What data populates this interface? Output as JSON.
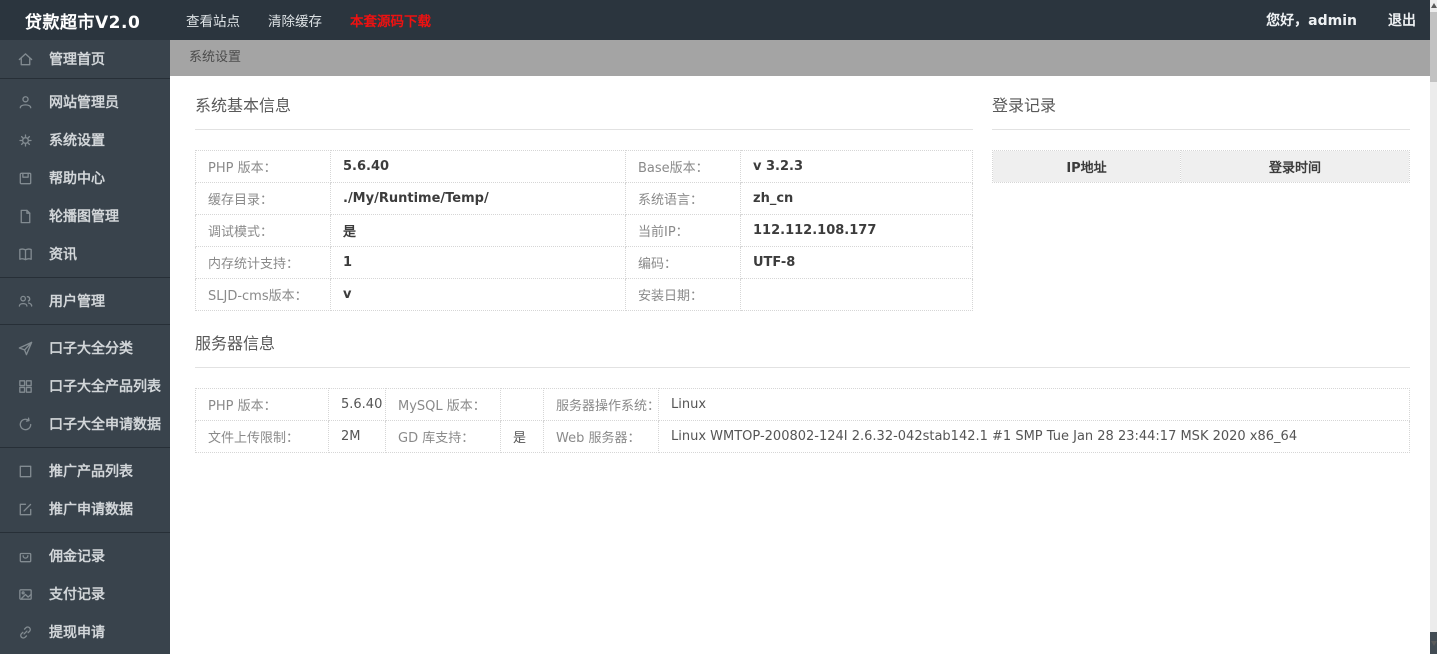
{
  "topbar": {
    "logo": "贷款超市V2.0",
    "menu": [
      {
        "label": "查看站点"
      },
      {
        "label": "清除缓存"
      },
      {
        "label": "本套源码下载"
      }
    ],
    "greeting": "您好，admin",
    "logout": "退出",
    "colors": {
      "background": "#2b353e",
      "danger_link": "#ee1111"
    }
  },
  "breadcrumb": {
    "label": "系统设置"
  },
  "sidebar": {
    "colors": {
      "background": "#39434c",
      "text": "#d2d6d9",
      "icon": "#828b91"
    },
    "items": [
      {
        "icon": "home-icon",
        "label": "管理首页"
      },
      {
        "icon": "user-icon",
        "label": "网站管理员"
      },
      {
        "icon": "gear-icon",
        "label": "系统设置"
      },
      {
        "icon": "save-icon",
        "label": "帮助中心"
      },
      {
        "icon": "file-icon",
        "label": "轮播图管理"
      },
      {
        "icon": "book-icon",
        "label": "资讯"
      },
      {
        "icon": "users-icon",
        "label": "用户管理"
      },
      {
        "icon": "send-icon",
        "label": "口子大全分类"
      },
      {
        "icon": "grid-icon",
        "label": "口子大全产品列表"
      },
      {
        "icon": "refresh-icon",
        "label": "口子大全申请数据"
      },
      {
        "icon": "square-icon",
        "label": "推广产品列表"
      },
      {
        "icon": "edit-icon",
        "label": "推广申请数据"
      },
      {
        "icon": "bag-icon",
        "label": "佣金记录"
      },
      {
        "icon": "image-icon",
        "label": "支付记录"
      },
      {
        "icon": "link-icon",
        "label": "提现申请"
      }
    ]
  },
  "sections": {
    "basic": {
      "title": "系统基本信息",
      "rows": [
        [
          "PHP 版本：",
          "5.6.40",
          "Base版本：",
          "v 3.2.3"
        ],
        [
          "缓存目录：",
          "./My/Runtime/Temp/",
          "系统语言：",
          "zh_cn"
        ],
        [
          "调试模式：",
          "是",
          "当前IP：",
          "112.112.108.177"
        ],
        [
          "内存统计支持：",
          "1",
          "编码：",
          "UTF-8"
        ],
        [
          "SLJD-cms版本：",
          "v",
          "安装日期：",
          ""
        ]
      ]
    },
    "login": {
      "title": "登录记录",
      "headers": [
        "IP地址",
        "登录时间"
      ],
      "rows": []
    },
    "server": {
      "title": "服务器信息",
      "rows": [
        [
          "PHP 版本：",
          "5.6.40",
          "MySQL 版本：",
          "",
          "服务器操作系统：",
          "Linux"
        ],
        [
          "文件上传限制：",
          "2M",
          "GD 库支持：",
          "是",
          "Web 服务器：",
          "Linux WMTOP-200802-124I 2.6.32-042stab142.1 #1 SMP Tue Jan 28 23:44:17 MSK 2020 x86_64"
        ]
      ]
    }
  }
}
